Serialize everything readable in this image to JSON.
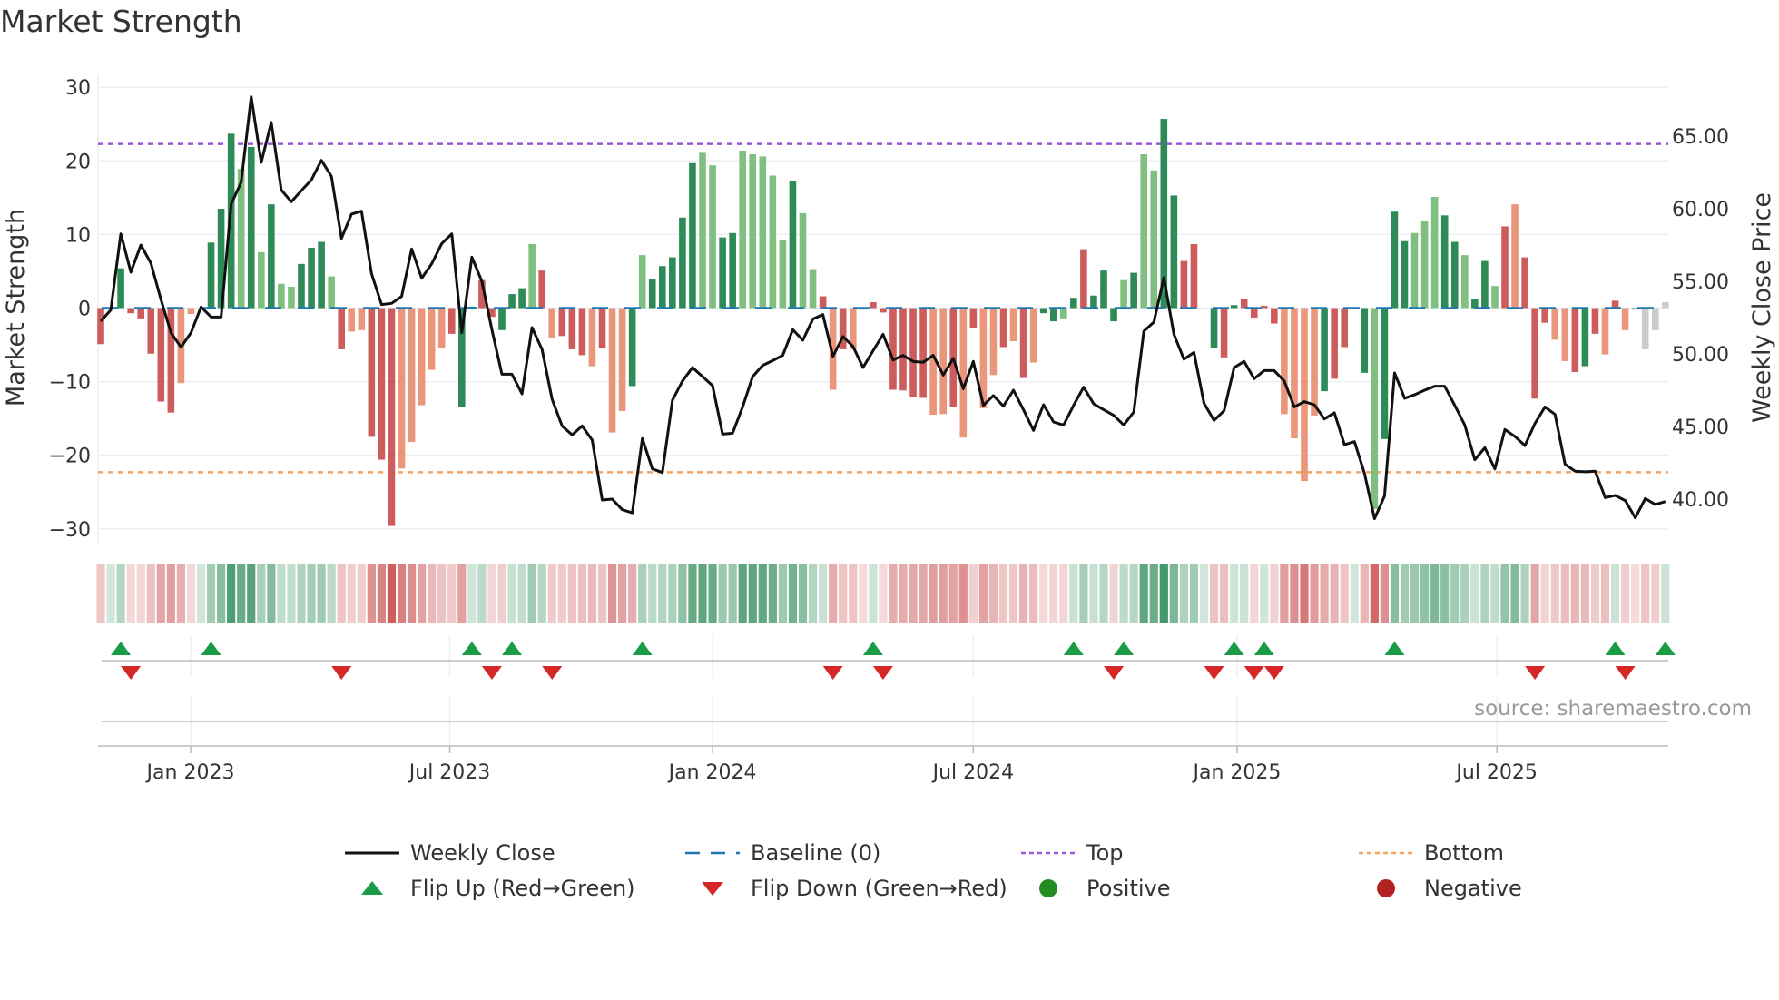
{
  "title": "Market Strength",
  "source": "source: sharemaestro.com",
  "chart_data": {
    "type": "bar",
    "title": "Market Strength",
    "ylabel": "Market Strength",
    "y2label": "Weekly Close Price",
    "ylim": [
      -31,
      31
    ],
    "yticks": [
      30,
      20,
      10,
      0,
      -10,
      -20,
      -30
    ],
    "yticklabels": [
      "30",
      "20",
      "10",
      "0",
      "−10",
      "−20",
      "−30"
    ],
    "y2lim": [
      37.97,
      68.36
    ],
    "y2ticks": [
      65,
      60,
      55,
      50,
      45,
      40
    ],
    "y2ticklabels": [
      "65.00",
      "60.00",
      "55.00",
      "50.00",
      "45.00",
      "40.00"
    ],
    "top_level": 22.3,
    "bottom_level": -22.3,
    "x_unit": "week index (1 = first weekly bar, approx. early Nov 2022)",
    "xticks": [
      {
        "week": 9.96,
        "label": "Jan 2023"
      },
      {
        "week": 35.8,
        "label": "Jul 2023"
      },
      {
        "week": 62.0,
        "label": "Jan 2024"
      },
      {
        "week": 88.0,
        "label": "Jul 2024"
      },
      {
        "week": 114.3,
        "label": "Jan 2025"
      },
      {
        "week": 140.2,
        "label": "Jul 2025"
      }
    ],
    "strength": [
      -4.9,
      0,
      5.4,
      -0.7,
      -1.4,
      -6.2,
      -12.7,
      -14.2,
      -10.2,
      -0.8,
      0,
      8.9,
      13.5,
      23.7,
      18.9,
      21.9,
      7.6,
      14.1,
      3.3,
      2.9,
      6.0,
      8.2,
      9.0,
      4.3,
      -5.6,
      -3.2,
      -3.0,
      -17.5,
      -20.6,
      -29.6,
      -21.8,
      -18.2,
      -13.2,
      -8.4,
      -5.5,
      -3.5,
      -13.4,
      0.2,
      3.8,
      -1.2,
      -3.0,
      1.9,
      2.7,
      8.7,
      5.1,
      -4.1,
      -3.8,
      -5.6,
      -6.4,
      -7.9,
      -5.5,
      -16.9,
      -14.0,
      -10.6,
      7.2,
      4.0,
      5.7,
      6.9,
      12.3,
      19.7,
      21.1,
      19.4,
      9.6,
      10.2,
      21.4,
      20.9,
      20.6,
      18.0,
      9.3,
      17.2,
      12.9,
      5.3,
      1.6,
      -11.1,
      -5.6,
      -5.6,
      -0.2,
      0.8,
      -0.6,
      -11.1,
      -11.2,
      -12.1,
      -12.2,
      -14.5,
      -14.4,
      -13.5,
      -17.6,
      -2.7,
      -13.6,
      -9.1,
      -5.3,
      -4.5,
      -9.5,
      -7.4,
      -0.7,
      -1.8,
      -1.4,
      1.4,
      8.0,
      1.7,
      5.1,
      -1.8,
      3.8,
      4.8,
      20.9,
      18.7,
      25.7,
      15.3,
      6.4,
      8.7,
      0,
      -5.4,
      -6.7,
      0.4,
      1.2,
      -1.3,
      0.3,
      -2.1,
      -14.4,
      -17.7,
      -23.5,
      -14.6,
      -11.3,
      -9.6,
      -5.3,
      0,
      -8.8,
      -27.3,
      -17.8,
      13.1,
      9.1,
      10.2,
      11.9,
      15.1,
      12.6,
      9.0,
      7.2,
      1.2,
      6.4,
      3.0,
      11.1,
      14.1,
      6.9,
      -12.3,
      -2.0,
      -4.3,
      -7.2,
      -8.7,
      -7.9,
      -3.5,
      -6.3,
      1.0,
      -3.0,
      -0.2,
      -5.6,
      -3.0,
      0.8
    ],
    "tones": "RGGRRRRRrrGGGGgGgGggGGGgRrrRRRrrrrrRGGRRGGGgRrRRRrRrrGgGGGGGggGGgggggGggRrRrGRRRRRRrrRrRrrRrRrGGgGRGGGgGggGGRRGGRGRRRRrrrrGRRrGgGGGgggGGgGGgRrRRRrrRGRrRrG",
    "tone_colors": {
      "G": "#2e8b57",
      "g": "#7fbf7f",
      "R": "#cd5c5c",
      "r": "#e9967a"
    },
    "weekly_close": [
      52.25,
      53.02,
      58.27,
      55.63,
      57.5,
      56.25,
      53.75,
      51.46,
      50.46,
      51.46,
      53.23,
      52.54,
      52.54,
      60.31,
      61.83,
      67.71,
      63.19,
      65.94,
      61.29,
      60.48,
      61.25,
      61.98,
      63.33,
      62.23,
      57.96,
      59.63,
      59.83,
      55.52,
      53.4,
      53.48,
      53.96,
      57.23,
      55.21,
      56.21,
      57.6,
      58.27,
      51.46,
      56.67,
      55.0,
      51.67,
      48.6,
      48.6,
      47.25,
      51.81,
      50.31,
      46.88,
      45.04,
      44.42,
      45.04,
      44.06,
      39.94,
      40.0,
      39.27,
      39.06,
      44.17,
      42.08,
      41.83,
      46.81,
      48.13,
      49.06,
      48.44,
      47.81,
      44.48,
      44.54,
      46.35,
      48.44,
      49.21,
      49.54,
      49.9,
      51.67,
      50.94,
      52.4,
      52.71,
      49.83,
      51.19,
      50.52,
      49.06,
      50.21,
      51.35,
      49.58,
      49.9,
      49.48,
      49.42,
      49.9,
      48.54,
      49.69,
      47.6,
      49.48,
      46.46,
      47.13,
      46.4,
      47.5,
      46.15,
      44.73,
      46.5,
      45.31,
      45.1,
      46.46,
      47.71,
      46.56,
      46.15,
      45.77,
      45.1,
      46.0,
      51.56,
      52.19,
      55.25,
      51.35,
      49.63,
      50.1,
      46.6,
      45.42,
      46.08,
      49.06,
      49.48,
      48.29,
      48.85,
      48.85,
      48.13,
      46.35,
      46.71,
      46.5,
      45.52,
      45.94,
      43.75,
      43.96,
      41.77,
      38.65,
      40.21,
      48.69,
      46.94,
      47.19,
      47.5,
      47.77,
      47.77,
      46.46,
      45.1,
      42.71,
      43.54,
      42.08,
      44.79,
      44.31,
      43.69,
      45.21,
      46.35,
      45.83,
      42.4,
      41.92,
      41.88,
      41.92,
      40.1,
      40.25,
      39.9,
      38.71,
      40.04,
      39.63,
      39.83
    ],
    "flip_up_weeks": [
      3,
      12,
      38,
      42,
      55,
      78,
      98,
      103,
      114,
      117,
      130,
      152,
      157
    ],
    "flip_down_weeks": [
      4,
      25,
      40,
      46,
      74,
      79,
      102,
      112,
      116,
      118,
      144,
      153
    ],
    "colors": {
      "line": "#111111",
      "baseline": "#1f77b4",
      "top": "#9b59d6",
      "bottom": "#f4a460",
      "flip_up": "#1a9c47",
      "flip_down": "#d62728",
      "positive": "#228b22",
      "negative": "#b22222",
      "heat_pos": "#2e8b57",
      "heat_neg": "#cd5c5c"
    },
    "legend": [
      {
        "key": "line",
        "label": "Weekly Close"
      },
      {
        "key": "baseline",
        "label": "Baseline (0)"
      },
      {
        "key": "top",
        "label": "Top"
      },
      {
        "key": "bottom",
        "label": "Bottom"
      },
      {
        "key": "flip_up",
        "label": "Flip Up (Red→Green)"
      },
      {
        "key": "flip_down",
        "label": "Flip Down (Green→Red)"
      },
      {
        "key": "positive",
        "label": "Positive"
      },
      {
        "key": "negative",
        "label": "Negative"
      }
    ]
  }
}
